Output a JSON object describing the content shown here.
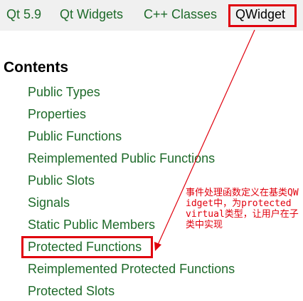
{
  "breadcrumb": {
    "items": [
      {
        "label": "Qt 5.9"
      },
      {
        "label": "Qt Widgets"
      },
      {
        "label": "C++ Classes"
      },
      {
        "label": "QWidget"
      }
    ]
  },
  "contents": {
    "title": "Contents",
    "items": [
      {
        "label": "Public Types"
      },
      {
        "label": "Properties"
      },
      {
        "label": "Public Functions"
      },
      {
        "label": "Reimplemented Public Functions"
      },
      {
        "label": "Public Slots"
      },
      {
        "label": "Signals"
      },
      {
        "label": "Static Public Members"
      },
      {
        "label": "Protected Functions"
      },
      {
        "label": "Reimplemented Protected Functions"
      },
      {
        "label": "Protected Slots"
      }
    ]
  },
  "annotation": {
    "text": "事件处理函数定义在基类QWidget中，为protected virtual类型，让用户在子类中实现"
  },
  "colors": {
    "link": "#1e6a2a",
    "highlight": "#e0000d",
    "breadcrumb_bg": "#f0f0f0"
  }
}
